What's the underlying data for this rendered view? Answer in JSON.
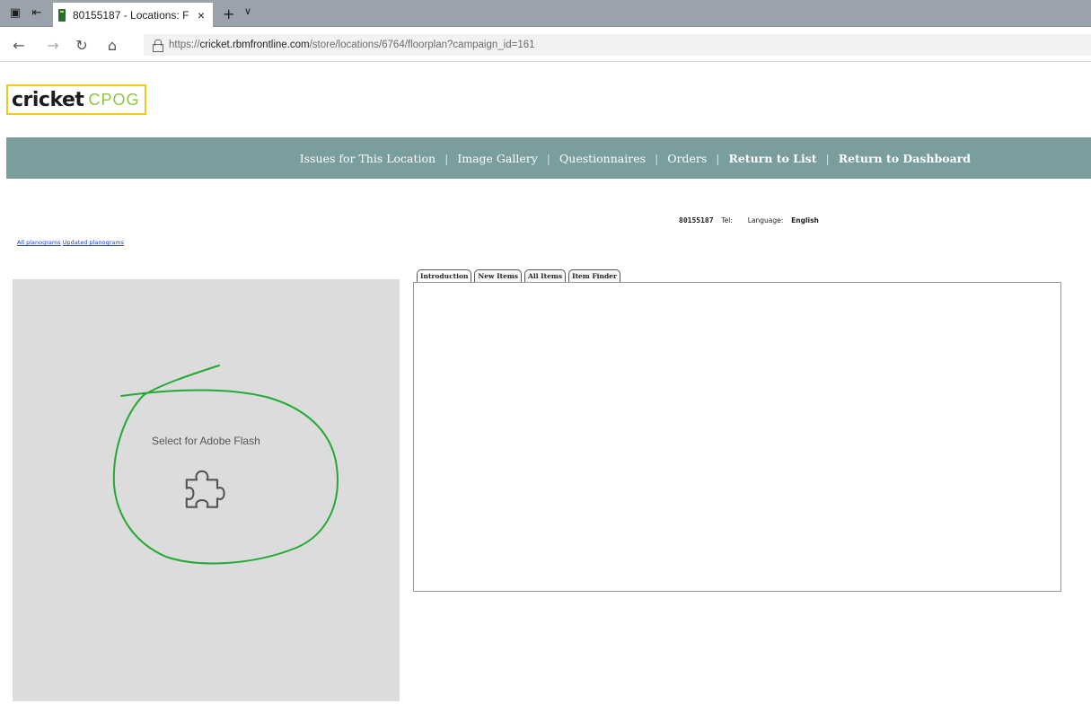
{
  "browser": {
    "tab_title": "80155187 - Locations: F",
    "tab_close": "×",
    "new_tab": "+",
    "tab_menu": "∨",
    "url_scheme": "https://",
    "url_host": "cricket.rbmfrontline.com",
    "url_path": "/store/locations/6764/floorplan?campaign_id=161",
    "icons": [
      "tab-actions-icon",
      "tab-set-aside-icon",
      "back-icon",
      "forward-icon",
      "refresh-icon",
      "home-icon",
      "lock-icon"
    ]
  },
  "logo": {
    "brand": "cricket",
    "suffix": "CPOG",
    "colors": {
      "border": "#f4c618",
      "accent": "#8dc63f"
    }
  },
  "nav": {
    "background": "#7a9d9d",
    "items": [
      {
        "label": "Issues for This Location",
        "bold": false
      },
      {
        "label": "Image Gallery",
        "bold": false
      },
      {
        "label": "Questionnaires",
        "bold": false
      },
      {
        "label": "Orders",
        "bold": false
      },
      {
        "label": "Return to List",
        "bold": true
      },
      {
        "label": "Return to Dashboard",
        "bold": true
      }
    ],
    "separator": "|"
  },
  "store": {
    "id": "80155187",
    "tel_label": "Tel:",
    "language_label": "Language:",
    "language": "English"
  },
  "planogram_links": {
    "all": "All planograms",
    "updated": "Updated planograms"
  },
  "flash": {
    "label": "Select for Adobe Flash",
    "icon": "puzzle-piece-icon"
  },
  "tabs": {
    "items": [
      "Introduction",
      "New Items",
      "All Items",
      "Item Finder"
    ],
    "active": "Introduction"
  },
  "annotation": {
    "color": "#22aa33"
  }
}
